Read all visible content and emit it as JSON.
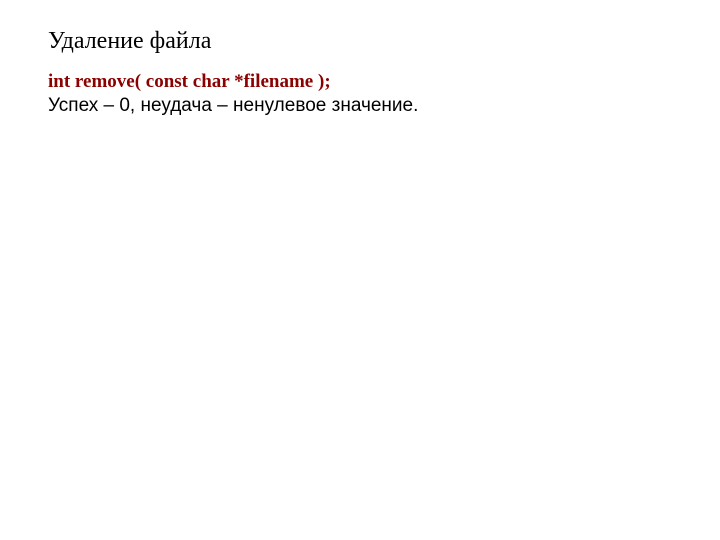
{
  "title": "Удаление файла",
  "signature": "int remove( const char *filename );",
  "description": "Успех – 0, неудача – ненулевое значение."
}
